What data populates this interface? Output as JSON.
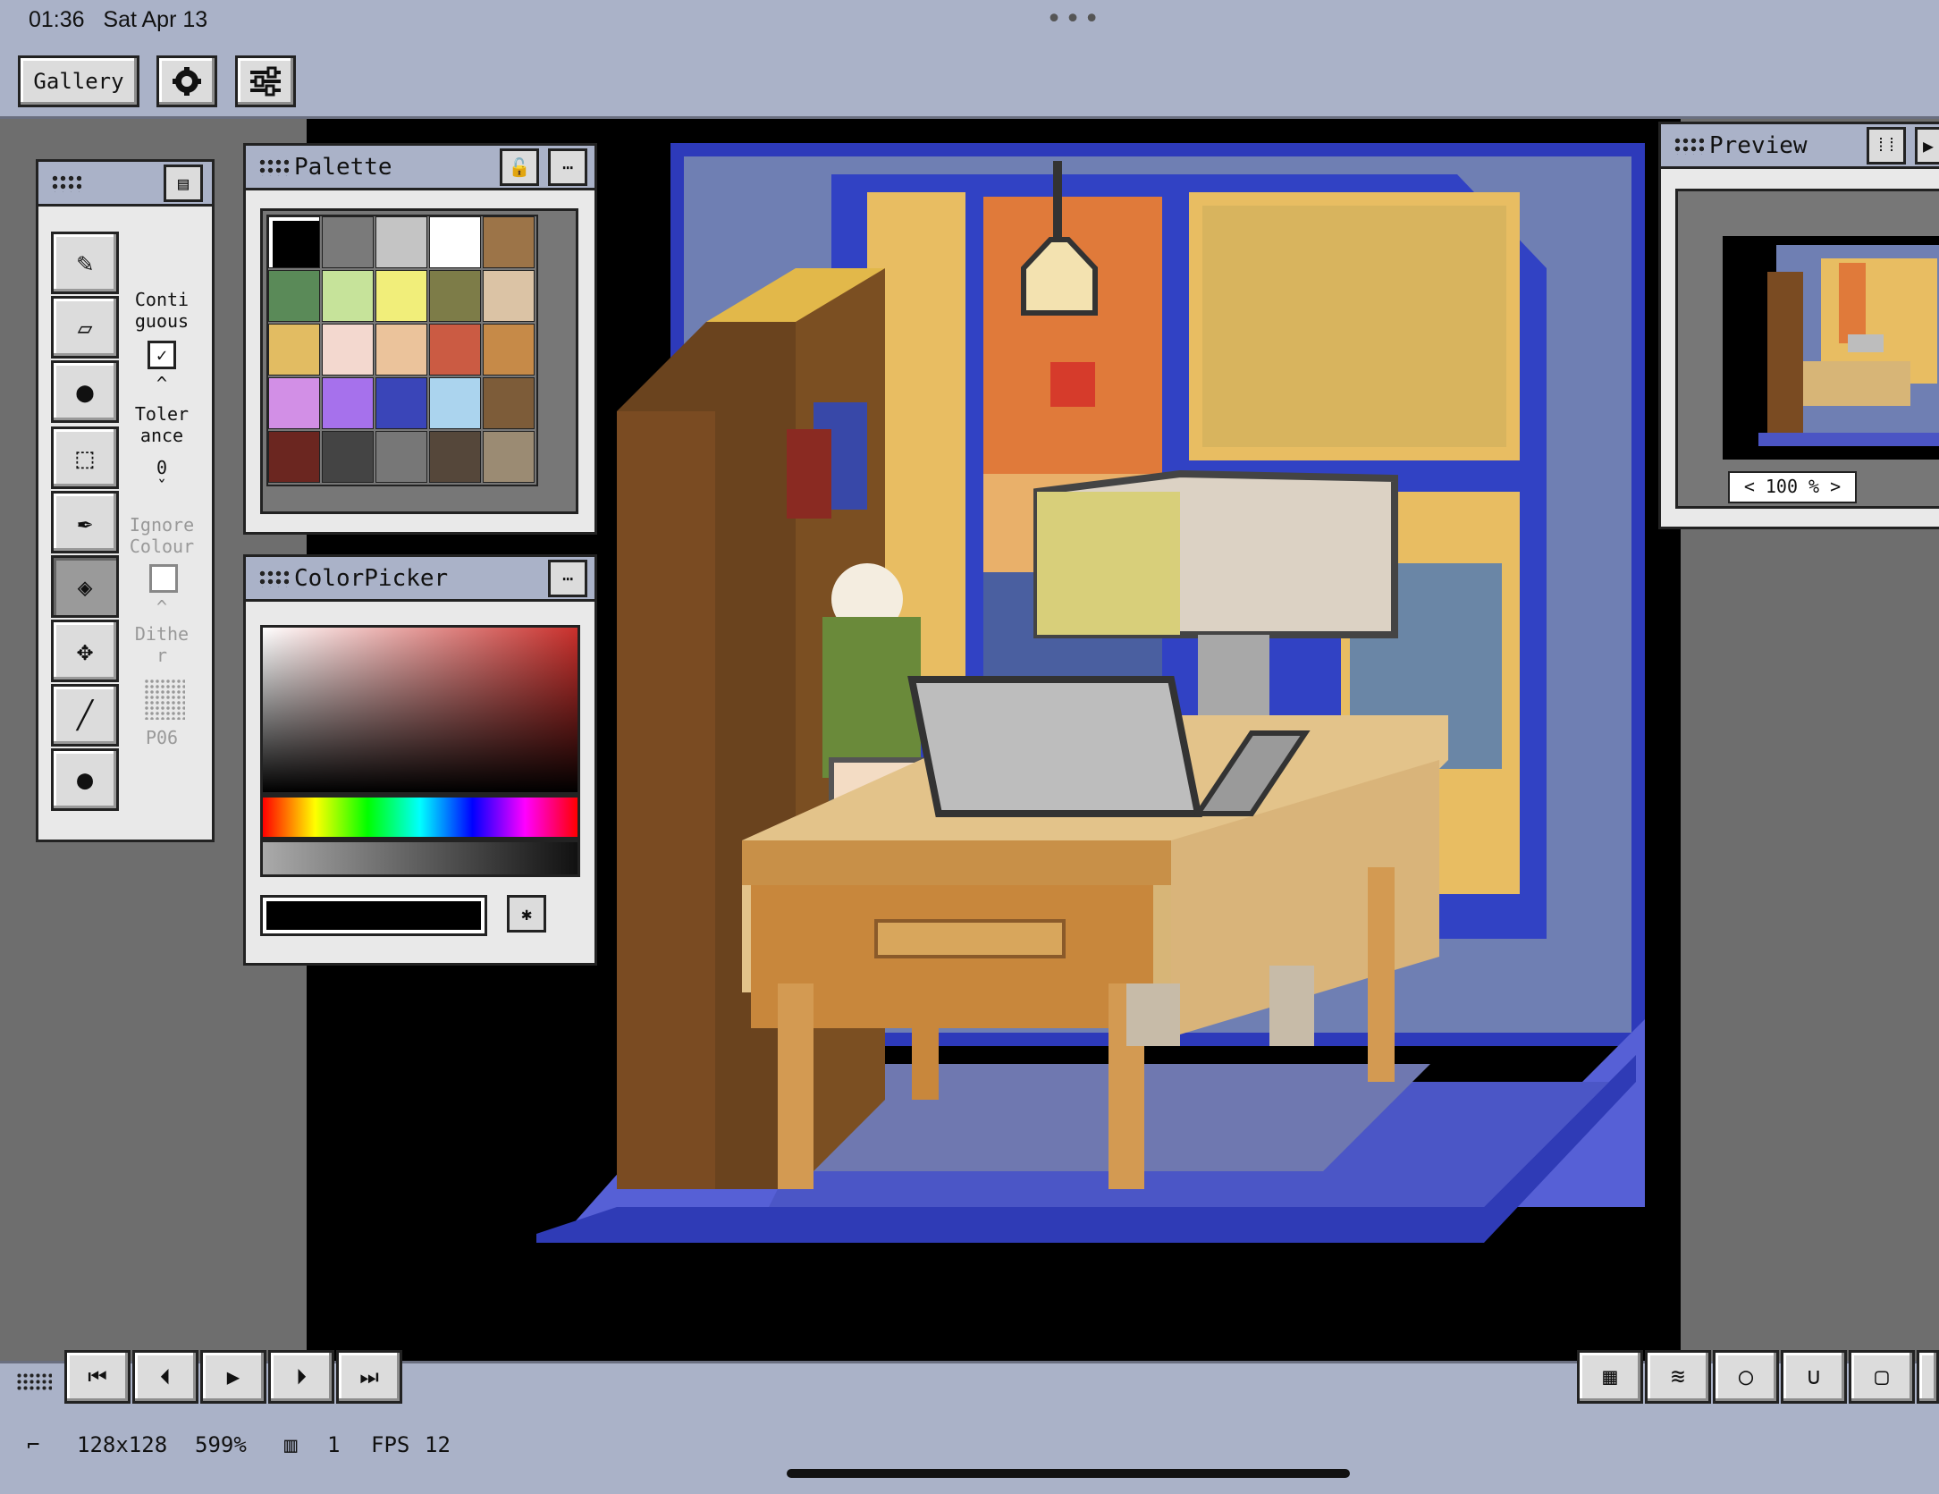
{
  "status": {
    "time": "01:36",
    "date": "Sat Apr 13",
    "dots": "•••"
  },
  "toolbar": {
    "gallery_label": "Gallery"
  },
  "tool_options": {
    "contiguous_label": "Conti\nguous",
    "tolerance_label": "Toler\nance",
    "tolerance_value": "0",
    "ignore_label": "Ignore\nColour",
    "dither_label": "Dithe\nr",
    "pattern_label": "P06",
    "caret_up": "^",
    "caret_down": "ˇ"
  },
  "palette": {
    "title": "Palette",
    "colors": [
      "#000000",
      "#7a7a7a",
      "#c4c4c4",
      "#ffffff",
      "#9c7448",
      "#5a8a58",
      "#c6e39a",
      "#f1ee7a",
      "#7d7c48",
      "#dbc3a5",
      "#e2bc62",
      "#f3d8cf",
      "#ebc39b",
      "#cb5b43",
      "#c68a48",
      "#d28fe6",
      "#a671ec",
      "#3a45b8",
      "#abd4ee",
      "#7d5c39",
      "#6b2620",
      "#444444",
      "#777777",
      "#55473a",
      "#9b8b73"
    ]
  },
  "colorpicker": {
    "title": "ColorPicker",
    "current_color": "#000000",
    "star": "✱"
  },
  "preview": {
    "title": "Preview",
    "zoom": "< 100 % >"
  },
  "footer": {
    "size": "128x128",
    "zoom": "599%",
    "frames": "1",
    "fps_label": "FPS",
    "fps": "12"
  },
  "colors": {
    "ui_bg": "#aab2c8",
    "canvas": "#000000",
    "room_blue": "#4b55c4"
  }
}
